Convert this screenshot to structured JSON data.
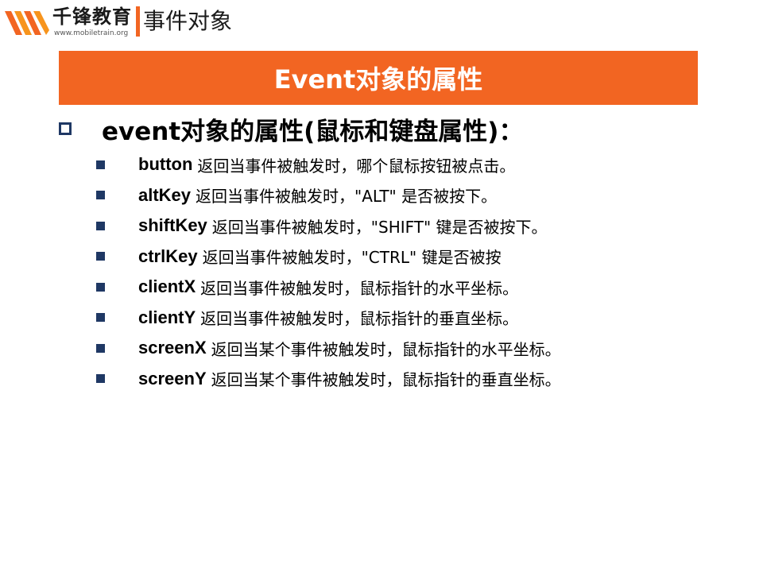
{
  "header": {
    "logo_cn": "千锋教育",
    "logo_url": "www.mobiletrain.org",
    "section_title": "事件对象",
    "accent_color": "#f26522"
  },
  "slide": {
    "title": "Event对象的属性",
    "main_bullet": "event对象的属性(鼠标和键盘属性)：",
    "bullet_color": "#1f3864",
    "properties": [
      {
        "name": "button",
        "desc": "返回当事件被触发时，哪个鼠标按钮被点击。"
      },
      {
        "name": "altKey",
        "desc": "返回当事件被触发时，\"ALT\" 是否被按下。"
      },
      {
        "name": "shiftKey",
        "desc": "返回当事件被触发时，\"SHIFT\" 键是否被按下。"
      },
      {
        "name": "ctrlKey",
        "desc": "返回当事件被触发时，\"CTRL\" 键是否被按"
      },
      {
        "name": "clientX",
        "desc": "返回当事件被触发时，鼠标指针的水平坐标。"
      },
      {
        "name": "clientY",
        "desc": "返回当事件被触发时，鼠标指针的垂直坐标。"
      },
      {
        "name": "screenX",
        "desc": "返回当某个事件被触发时，鼠标指针的水平坐标。"
      },
      {
        "name": "screenY",
        "desc": "返回当某个事件被触发时，鼠标指针的垂直坐标。"
      }
    ]
  }
}
